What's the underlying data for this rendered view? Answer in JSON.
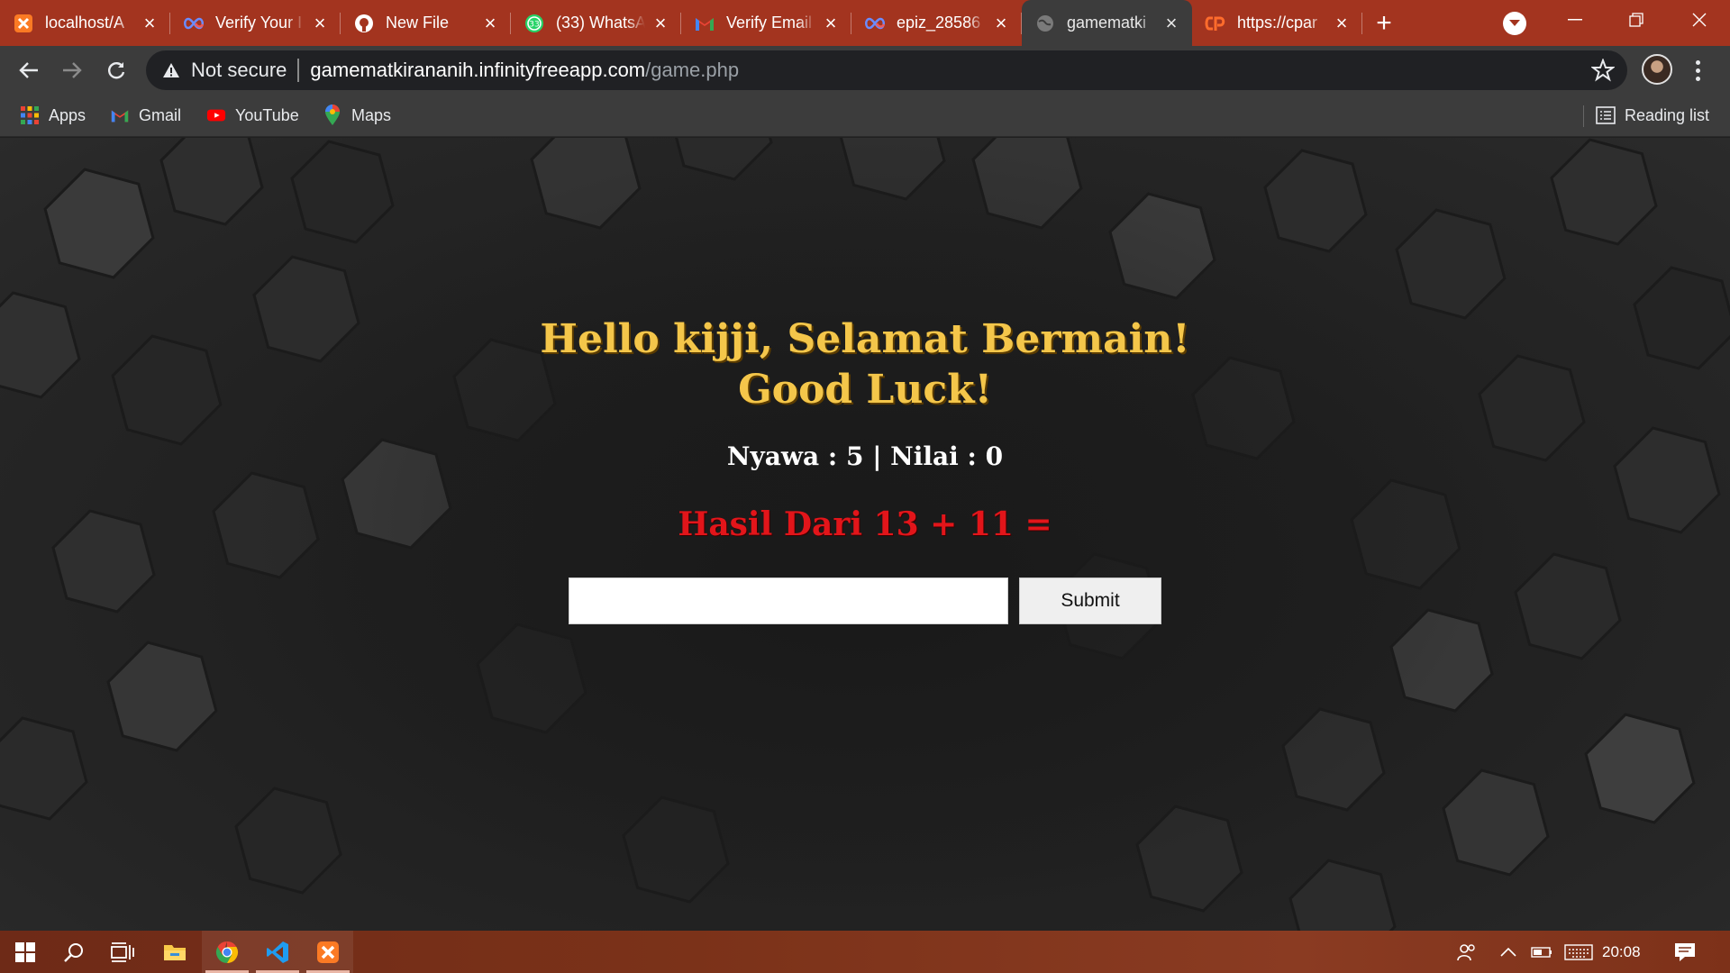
{
  "browser": {
    "tabs": [
      {
        "title": "localhost/A",
        "icon": "xampp-icon",
        "active": false
      },
      {
        "title": "Verify Your I",
        "icon": "infinity-icon",
        "active": false
      },
      {
        "title": "New File",
        "icon": "github-icon",
        "active": false
      },
      {
        "title": "(33) WhatsA",
        "icon": "whatsapp-icon",
        "active": false
      },
      {
        "title": "Verify Email",
        "icon": "gmail-icon",
        "active": false
      },
      {
        "title": "epiz_28586",
        "icon": "infinity-icon",
        "active": false
      },
      {
        "title": "gamematki",
        "icon": "globe-icon",
        "active": true
      },
      {
        "title": "https://cpar",
        "icon": "cpanel-icon",
        "active": false
      }
    ],
    "new_tab_label": "+",
    "address": {
      "security_label": "Not secure",
      "host": "gamematkirananih.infinityfreeapp.com",
      "path": "/game.php"
    },
    "bookmarks": [
      {
        "label": "Apps",
        "icon": "apps-grid-icon"
      },
      {
        "label": "Gmail",
        "icon": "gmail-icon"
      },
      {
        "label": "YouTube",
        "icon": "youtube-icon"
      },
      {
        "label": "Maps",
        "icon": "maps-pin-icon"
      }
    ],
    "reading_list_label": "Reading list",
    "colors": {
      "tabstrip": "#a3341f",
      "toolbar": "#3c3c3c",
      "omnibox": "#202124"
    }
  },
  "game": {
    "greeting_line1": "Hello kijji, Selamat Bermain!",
    "greeting_line2": "Good Luck!",
    "stats": "Nyawa : 5 | Nilai : 0",
    "question": "Hasil Dari 13 + 11 =",
    "answer_value": "",
    "answer_placeholder": "",
    "submit_label": "Submit",
    "colors": {
      "greeting": "#f4c64a",
      "stats": "#ffffff",
      "question": "#e2151a"
    }
  },
  "taskbar": {
    "apps": [
      {
        "name": "start",
        "icon": "windows-icon"
      },
      {
        "name": "search",
        "icon": "search-icon"
      },
      {
        "name": "task-view",
        "icon": "task-view-icon"
      },
      {
        "name": "file-explorer",
        "icon": "folder-icon"
      },
      {
        "name": "chrome",
        "icon": "chrome-icon",
        "running": true
      },
      {
        "name": "vscode",
        "icon": "vscode-icon",
        "running": true
      },
      {
        "name": "xampp",
        "icon": "xampp-icon",
        "running": true
      }
    ],
    "clock": "20:08"
  }
}
